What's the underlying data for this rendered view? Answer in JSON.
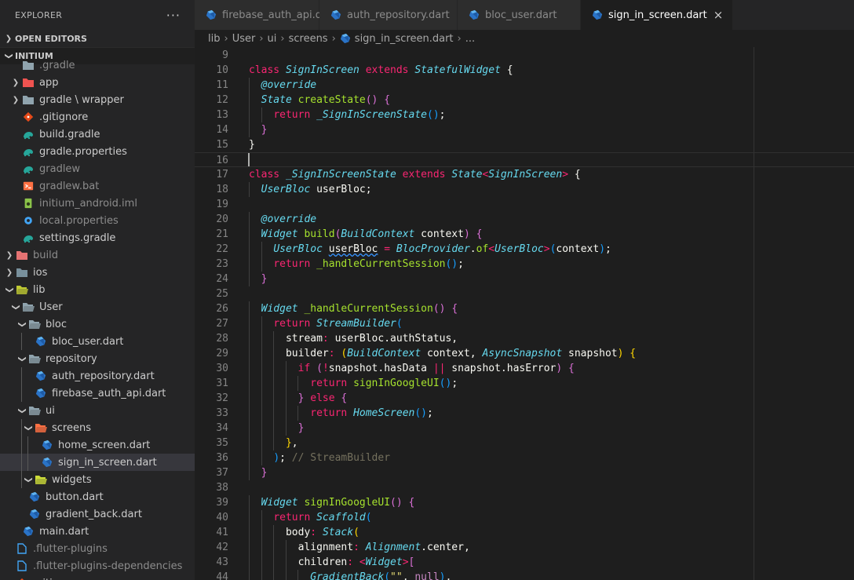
{
  "explorer": {
    "title": "EXPLORER",
    "more_icon": "ellipsis-icon",
    "open_editors_label": "OPEN EDITORS",
    "project_label": "INITIUM"
  },
  "tree": [
    {
      "label": ".gradle",
      "depth": 2,
      "kind": "folder",
      "icon": "folder-icon",
      "chev": "none",
      "dim": true,
      "partial": true
    },
    {
      "label": "app",
      "depth": 2,
      "kind": "folder",
      "icon": "folder-app-icon",
      "chev": "right"
    },
    {
      "label": "gradle \\ wrapper",
      "depth": 2,
      "kind": "folder",
      "icon": "folder-icon",
      "chev": "right"
    },
    {
      "label": ".gitignore",
      "depth": 2,
      "kind": "file",
      "icon": "git-icon"
    },
    {
      "label": "build.gradle",
      "depth": 2,
      "kind": "file",
      "icon": "gradle-icon"
    },
    {
      "label": "gradle.properties",
      "depth": 2,
      "kind": "file",
      "icon": "gradle-icon"
    },
    {
      "label": "gradlew",
      "depth": 2,
      "kind": "file",
      "icon": "gradle-icon",
      "dim": true
    },
    {
      "label": "gradlew.bat",
      "depth": 2,
      "kind": "file",
      "icon": "terminal-icon",
      "dim": true
    },
    {
      "label": "initium_android.iml",
      "depth": 2,
      "kind": "file",
      "icon": "android-icon",
      "dim": true
    },
    {
      "label": "local.properties",
      "depth": 2,
      "kind": "file",
      "icon": "gear-icon",
      "dim": true
    },
    {
      "label": "settings.gradle",
      "depth": 2,
      "kind": "file",
      "icon": "gradle-icon"
    },
    {
      "label": "build",
      "depth": 1,
      "kind": "folder",
      "icon": "folder-build-icon",
      "chev": "right",
      "dim": true
    },
    {
      "label": "ios",
      "depth": 1,
      "kind": "folder",
      "icon": "folder-ios-icon",
      "chev": "right"
    },
    {
      "label": "lib",
      "depth": 1,
      "kind": "folder",
      "icon": "folder-lib-icon",
      "chev": "down"
    },
    {
      "label": "User",
      "depth": 2,
      "kind": "folder",
      "icon": "folder-open-icon",
      "chev": "down"
    },
    {
      "label": "bloc",
      "depth": 3,
      "kind": "folder",
      "icon": "folder-open-icon",
      "chev": "down"
    },
    {
      "label": "bloc_user.dart",
      "depth": 4,
      "kind": "file",
      "icon": "dart-icon"
    },
    {
      "label": "repository",
      "depth": 3,
      "kind": "folder",
      "icon": "folder-open-icon",
      "chev": "down"
    },
    {
      "label": "auth_repository.dart",
      "depth": 4,
      "kind": "file",
      "icon": "dart-icon"
    },
    {
      "label": "firebase_auth_api.dart",
      "depth": 4,
      "kind": "file",
      "icon": "dart-icon"
    },
    {
      "label": "ui",
      "depth": 3,
      "kind": "folder",
      "icon": "folder-open-icon",
      "chev": "down"
    },
    {
      "label": "screens",
      "depth": 4,
      "kind": "folder",
      "icon": "folder-screens-icon",
      "chev": "down"
    },
    {
      "label": "home_screen.dart",
      "depth": 5,
      "kind": "file",
      "icon": "dart-icon"
    },
    {
      "label": "sign_in_screen.dart",
      "depth": 5,
      "kind": "file",
      "icon": "dart-icon",
      "active": true
    },
    {
      "label": "widgets",
      "depth": 4,
      "kind": "folder",
      "icon": "folder-widgets-icon",
      "chev": "down"
    },
    {
      "label": "button.dart",
      "depth": 3,
      "kind": "file",
      "icon": "dart-icon"
    },
    {
      "label": "gradient_back.dart",
      "depth": 3,
      "kind": "file",
      "icon": "dart-icon"
    },
    {
      "label": "main.dart",
      "depth": 2,
      "kind": "file",
      "icon": "dart-icon"
    },
    {
      "label": ".flutter-plugins",
      "depth": 1,
      "kind": "file",
      "icon": "file-icon",
      "dim": true
    },
    {
      "label": ".flutter-plugins-dependencies",
      "depth": 1,
      "kind": "file",
      "icon": "file-icon",
      "dim": true
    },
    {
      "label": ".gitignore",
      "depth": 1,
      "kind": "file",
      "icon": "git-icon",
      "partial": true
    }
  ],
  "tabs": [
    {
      "label": "firebase_auth_api.dart",
      "icon": "dart-icon",
      "active": false
    },
    {
      "label": "auth_repository.dart",
      "icon": "dart-icon",
      "active": false
    },
    {
      "label": "bloc_user.dart",
      "icon": "dart-icon",
      "active": false
    },
    {
      "label": "sign_in_screen.dart",
      "icon": "dart-icon",
      "active": true,
      "close": "×"
    }
  ],
  "breadcrumb": {
    "parts": [
      "lib",
      "User",
      "ui",
      "screens",
      "sign_in_screen.dart",
      "..."
    ],
    "separator": "›"
  },
  "editor": {
    "current_line": 16,
    "lines": [
      {
        "n": 9,
        "tokens": []
      },
      {
        "n": 10,
        "tokens": [
          [
            "kw",
            "class "
          ],
          [
            "ty",
            "SignInScreen"
          ],
          [
            "kw",
            " extends "
          ],
          [
            "ty",
            "StatefulWidget"
          ],
          [
            "pr",
            " {"
          ]
        ]
      },
      {
        "n": 11,
        "tokens": [
          [
            "pr",
            "  "
          ],
          [
            "an",
            "@override"
          ]
        ]
      },
      {
        "n": 12,
        "tokens": [
          [
            "pr",
            "  "
          ],
          [
            "ty",
            "State"
          ],
          [
            "pr",
            " "
          ],
          [
            "fn",
            "createState"
          ],
          [
            "br2",
            "()"
          ],
          [
            "pr",
            " "
          ],
          [
            "br2",
            "{"
          ]
        ]
      },
      {
        "n": 13,
        "tokens": [
          [
            "pr",
            "    "
          ],
          [
            "kw",
            "return"
          ],
          [
            "pr",
            " "
          ],
          [
            "ty",
            "_SignInScreenState"
          ],
          [
            "br3",
            "()"
          ],
          [
            "pr",
            ";"
          ]
        ]
      },
      {
        "n": 14,
        "tokens": [
          [
            "pr",
            "  "
          ],
          [
            "br2",
            "}"
          ]
        ]
      },
      {
        "n": 15,
        "tokens": [
          [
            "pr",
            "}"
          ]
        ]
      },
      {
        "n": 16,
        "tokens": []
      },
      {
        "n": 17,
        "tokens": [
          [
            "kw",
            "class "
          ],
          [
            "ty",
            "_SignInScreenState"
          ],
          [
            "kw",
            " extends "
          ],
          [
            "ty",
            "State"
          ],
          [
            "op",
            "<"
          ],
          [
            "ty",
            "SignInScreen"
          ],
          [
            "op",
            ">"
          ],
          [
            "pr",
            " {"
          ]
        ]
      },
      {
        "n": 18,
        "tokens": [
          [
            "pr",
            "  "
          ],
          [
            "ty",
            "UserBloc"
          ],
          [
            "pr",
            " userBloc;"
          ]
        ]
      },
      {
        "n": 19,
        "tokens": []
      },
      {
        "n": 20,
        "tokens": [
          [
            "pr",
            "  "
          ],
          [
            "an",
            "@override"
          ]
        ]
      },
      {
        "n": 21,
        "tokens": [
          [
            "pr",
            "  "
          ],
          [
            "ty",
            "Widget"
          ],
          [
            "pr",
            " "
          ],
          [
            "fn",
            "build"
          ],
          [
            "br2",
            "("
          ],
          [
            "ty",
            "BuildContext"
          ],
          [
            "pr",
            " context"
          ],
          [
            "br2",
            ")"
          ],
          [
            "pr",
            " "
          ],
          [
            "br2",
            "{"
          ]
        ]
      },
      {
        "n": 22,
        "tokens": [
          [
            "pr",
            "    "
          ],
          [
            "ty",
            "UserBloc"
          ],
          [
            "pr",
            " "
          ],
          [
            "sq",
            "userBloc"
          ],
          [
            "pr",
            " "
          ],
          [
            "op",
            "="
          ],
          [
            "pr",
            " "
          ],
          [
            "ty",
            "BlocProvider"
          ],
          [
            "pr",
            "."
          ],
          [
            "fn",
            "of"
          ],
          [
            "op",
            "<"
          ],
          [
            "ty",
            "UserBloc"
          ],
          [
            "op",
            ">"
          ],
          [
            "br3",
            "("
          ],
          [
            "pr",
            "context"
          ],
          [
            "br3",
            ")"
          ],
          [
            "pr",
            ";"
          ]
        ]
      },
      {
        "n": 23,
        "tokens": [
          [
            "pr",
            "    "
          ],
          [
            "kw",
            "return"
          ],
          [
            "pr",
            " "
          ],
          [
            "fn",
            "_handleCurrentSession"
          ],
          [
            "br3",
            "()"
          ],
          [
            "pr",
            ";"
          ]
        ]
      },
      {
        "n": 24,
        "tokens": [
          [
            "pr",
            "  "
          ],
          [
            "br2",
            "}"
          ]
        ]
      },
      {
        "n": 25,
        "tokens": []
      },
      {
        "n": 26,
        "tokens": [
          [
            "pr",
            "  "
          ],
          [
            "ty",
            "Widget"
          ],
          [
            "pr",
            " "
          ],
          [
            "fn",
            "_handleCurrentSession"
          ],
          [
            "br2",
            "()"
          ],
          [
            "pr",
            " "
          ],
          [
            "br2",
            "{"
          ]
        ]
      },
      {
        "n": 27,
        "tokens": [
          [
            "pr",
            "    "
          ],
          [
            "kw",
            "return"
          ],
          [
            "pr",
            " "
          ],
          [
            "ty",
            "StreamBuilder"
          ],
          [
            "br3",
            "("
          ]
        ]
      },
      {
        "n": 28,
        "tokens": [
          [
            "pr",
            "      stream"
          ],
          [
            "op",
            ":"
          ],
          [
            "pr",
            " userBloc.authStatus,"
          ]
        ]
      },
      {
        "n": 29,
        "tokens": [
          [
            "pr",
            "      builder"
          ],
          [
            "op",
            ":"
          ],
          [
            "pr",
            " "
          ],
          [
            "br1",
            "("
          ],
          [
            "ty",
            "BuildContext"
          ],
          [
            "pr",
            " context, "
          ],
          [
            "ty",
            "AsyncSnapshot"
          ],
          [
            "pr",
            " snapshot"
          ],
          [
            "br1",
            ")"
          ],
          [
            "pr",
            " "
          ],
          [
            "br1",
            "{"
          ]
        ]
      },
      {
        "n": 30,
        "tokens": [
          [
            "pr",
            "        "
          ],
          [
            "kw",
            "if"
          ],
          [
            "pr",
            " "
          ],
          [
            "br2",
            "("
          ],
          [
            "op",
            "!"
          ],
          [
            "pr",
            "snapshot.hasData "
          ],
          [
            "op",
            "||"
          ],
          [
            "pr",
            " snapshot.hasError"
          ],
          [
            "br2",
            ")"
          ],
          [
            "pr",
            " "
          ],
          [
            "br2",
            "{"
          ]
        ]
      },
      {
        "n": 31,
        "tokens": [
          [
            "pr",
            "          "
          ],
          [
            "kw",
            "return"
          ],
          [
            "pr",
            " "
          ],
          [
            "fn",
            "signInGoogleUI"
          ],
          [
            "br3",
            "()"
          ],
          [
            "pr",
            ";"
          ]
        ]
      },
      {
        "n": 32,
        "tokens": [
          [
            "pr",
            "        "
          ],
          [
            "br2",
            "}"
          ],
          [
            "pr",
            " "
          ],
          [
            "kw",
            "else"
          ],
          [
            "pr",
            " "
          ],
          [
            "br2",
            "{"
          ]
        ]
      },
      {
        "n": 33,
        "tokens": [
          [
            "pr",
            "          "
          ],
          [
            "kw",
            "return"
          ],
          [
            "pr",
            " "
          ],
          [
            "ty",
            "HomeScreen"
          ],
          [
            "br3",
            "()"
          ],
          [
            "pr",
            ";"
          ]
        ]
      },
      {
        "n": 34,
        "tokens": [
          [
            "pr",
            "        "
          ],
          [
            "br2",
            "}"
          ]
        ]
      },
      {
        "n": 35,
        "tokens": [
          [
            "pr",
            "      "
          ],
          [
            "br1",
            "}"
          ],
          [
            "pr",
            ","
          ]
        ]
      },
      {
        "n": 36,
        "tokens": [
          [
            "pr",
            "    "
          ],
          [
            "br3",
            ")"
          ],
          [
            "pr",
            "; "
          ],
          [
            "cm",
            "// StreamBuilder"
          ]
        ]
      },
      {
        "n": 37,
        "tokens": [
          [
            "pr",
            "  "
          ],
          [
            "br2",
            "}"
          ]
        ]
      },
      {
        "n": 38,
        "tokens": []
      },
      {
        "n": 39,
        "tokens": [
          [
            "pr",
            "  "
          ],
          [
            "ty",
            "Widget"
          ],
          [
            "pr",
            " "
          ],
          [
            "fn",
            "signInGoogleUI"
          ],
          [
            "br2",
            "()"
          ],
          [
            "pr",
            " "
          ],
          [
            "br2",
            "{"
          ]
        ]
      },
      {
        "n": 40,
        "tokens": [
          [
            "pr",
            "    "
          ],
          [
            "kw",
            "return"
          ],
          [
            "pr",
            " "
          ],
          [
            "ty",
            "Scaffold"
          ],
          [
            "br3",
            "("
          ]
        ]
      },
      {
        "n": 41,
        "tokens": [
          [
            "pr",
            "      body"
          ],
          [
            "op",
            ":"
          ],
          [
            "pr",
            " "
          ],
          [
            "ty",
            "Stack"
          ],
          [
            "br1",
            "("
          ]
        ]
      },
      {
        "n": 42,
        "tokens": [
          [
            "pr",
            "        alignment"
          ],
          [
            "op",
            ":"
          ],
          [
            "pr",
            " "
          ],
          [
            "ty",
            "Alignment"
          ],
          [
            "pr",
            ".center,"
          ]
        ]
      },
      {
        "n": 43,
        "tokens": [
          [
            "pr",
            "        children"
          ],
          [
            "op",
            ":"
          ],
          [
            "pr",
            " "
          ],
          [
            "op",
            "<"
          ],
          [
            "ty",
            "Widget"
          ],
          [
            "op",
            ">"
          ],
          [
            "br2",
            "["
          ]
        ]
      },
      {
        "n": 44,
        "tokens": [
          [
            "pr",
            "          "
          ],
          [
            "ty",
            "GradientBack"
          ],
          [
            "br3",
            "("
          ],
          [
            "st",
            "\"\""
          ],
          [
            "pr",
            ", "
          ],
          [
            "kwp",
            "null"
          ],
          [
            "br3",
            ")"
          ],
          [
            "pr",
            ","
          ]
        ]
      }
    ]
  }
}
